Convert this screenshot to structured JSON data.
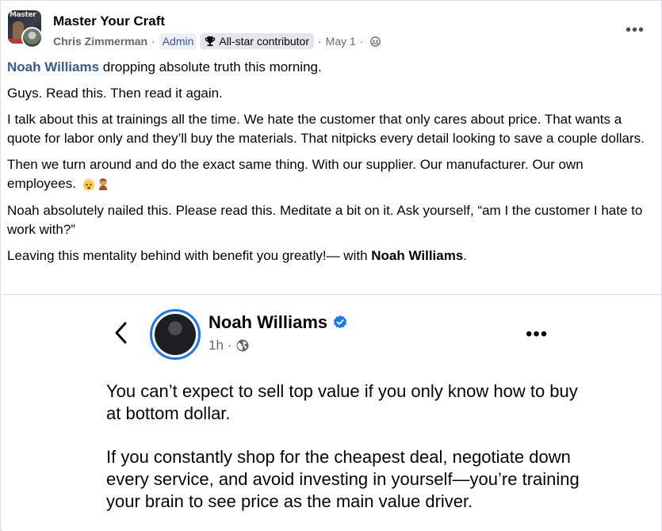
{
  "header": {
    "group_name": "Master Your Craft",
    "group_avatar_text": "Master",
    "author_name": "Chris Zimmerman",
    "admin_label": "Admin",
    "badge_label": "All-star contributor",
    "date": "May 1",
    "more_label": "•••"
  },
  "body": {
    "p1_mention": "Noah Williams",
    "p1_text": " dropping absolute truth this morning.",
    "p2": "Guys. Read this. Then read it again.",
    "p3": "I talk about this at trainings all the time. We hate the customer that only cares about price. That wants a quote for labor only and they’ll buy the materials. That nitpicks every detail looking to save a couple dollars.",
    "p4": "Then we turn around and do the exact same thing. With our supplier. Our manufacturer. Our own employees.",
    "p5": "Noah absolutely nailed this. Please read this. Meditate a bit on it. Ask yourself, “am I the customer I hate to work with?”",
    "p6_text": "Leaving this mentality behind with benefit you greatly!— with ",
    "p6_mention": "Noah Williams",
    "p6_end": "."
  },
  "embed": {
    "name": "Noah Williams",
    "time": "1h ·",
    "more_label": "•••",
    "para1": "You can’t expect to sell top value if you only know how to buy at bottom dollar.",
    "para2": "If you constantly shop for the cheapest deal, negotiate down every service, and avoid investing in yourself—you’re training your brain to see price as the main value driver."
  },
  "icons": {
    "trophy": "trophy-icon",
    "globe": "globe-icon",
    "verified": "verified-badge-icon",
    "back": "back-arrow-icon",
    "emoji1": "exploding-head-emoji",
    "emoji2": "person-facepalming-emoji"
  },
  "colors": {
    "accent": "#385898",
    "verified": "#1877f2",
    "meta": "#65676b"
  }
}
